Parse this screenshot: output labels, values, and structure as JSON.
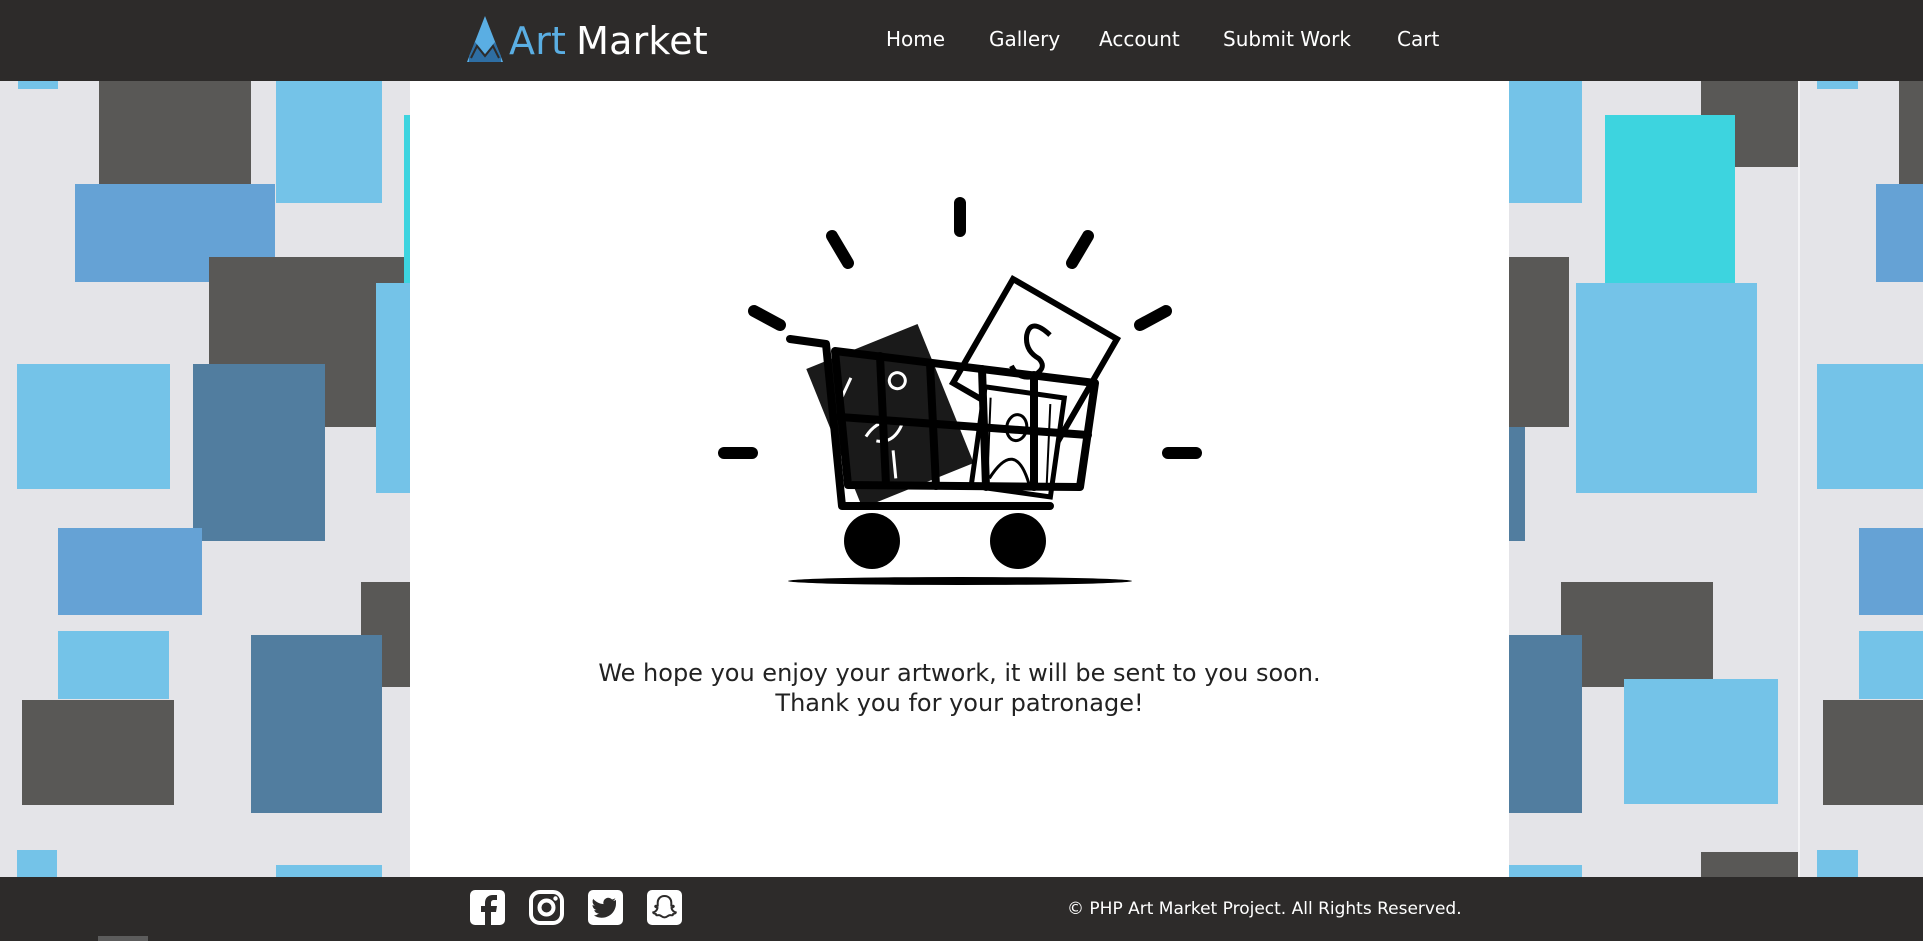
{
  "header": {
    "brand_part1": "Art",
    "brand_part2": "Market",
    "logo_icon": "triangle-mountain-logo",
    "nav": [
      {
        "label": "Home"
      },
      {
        "label": "Gallery"
      },
      {
        "label": "Account"
      },
      {
        "label": "Submit Work"
      },
      {
        "label": "Cart"
      }
    ]
  },
  "main": {
    "illustration": "shopping-cart-with-artworks-icon",
    "message_line1": "We hope you enjoy your artwork, it will be sent to you soon.",
    "message_line2": "Thank you for your patronage!"
  },
  "footer": {
    "social_icons": [
      "facebook-icon",
      "instagram-icon",
      "twitter-icon",
      "snapchat-icon"
    ],
    "copyright": "© PHP Art Market Project. All Rights Reserved."
  },
  "colors": {
    "header_bg": "#2d2b2a",
    "brand_accent": "#5aaee3",
    "page_bg": "#e4e4e8",
    "tile_dark": "#595856",
    "tile_light_blue": "#74c3e8",
    "tile_mid_blue": "#65a2d5",
    "tile_steel_blue": "#517d9f",
    "tile_cyan": "#3dd4df"
  }
}
